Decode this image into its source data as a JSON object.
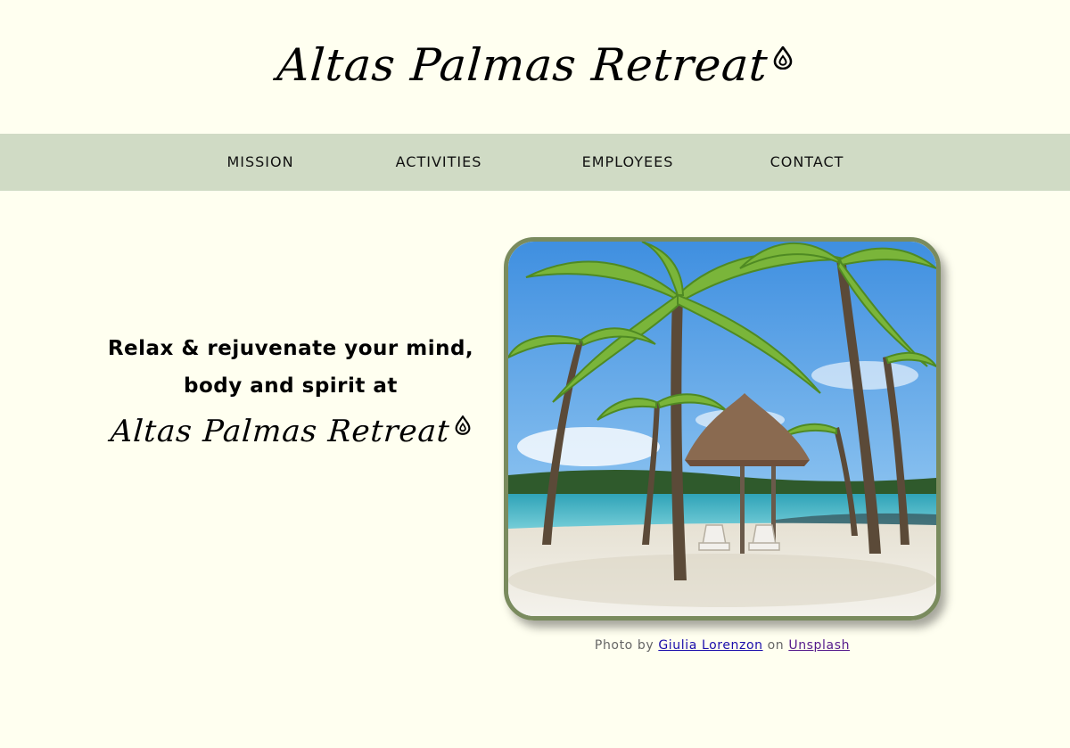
{
  "site": {
    "title": "Altas Palmas Retreat"
  },
  "nav": {
    "items": [
      {
        "label": "MISSION"
      },
      {
        "label": "ACTIVITIES"
      },
      {
        "label": "EMPLOYEES"
      },
      {
        "label": "CONTACT"
      }
    ]
  },
  "hero": {
    "tagline_line1": "Relax & rejuvenate your mind,",
    "tagline_line2": "body and spirit at",
    "brand_name": "Altas Palmas Retreat"
  },
  "photo": {
    "alt": "Photo by Giulia Lorenzon on Unsplash",
    "credit_prefix": "Photo by ",
    "author": "Giulia Lorenzon",
    "credit_middle": " on ",
    "site": "Unsplash"
  },
  "colors": {
    "background": "#fffff0",
    "nav_background": "#d0dbc5",
    "frame_border": "#7a8b5e",
    "author_link": "#1a0dab",
    "site_link": "#551a8b"
  },
  "icons": {
    "logo": "drop-icon"
  }
}
